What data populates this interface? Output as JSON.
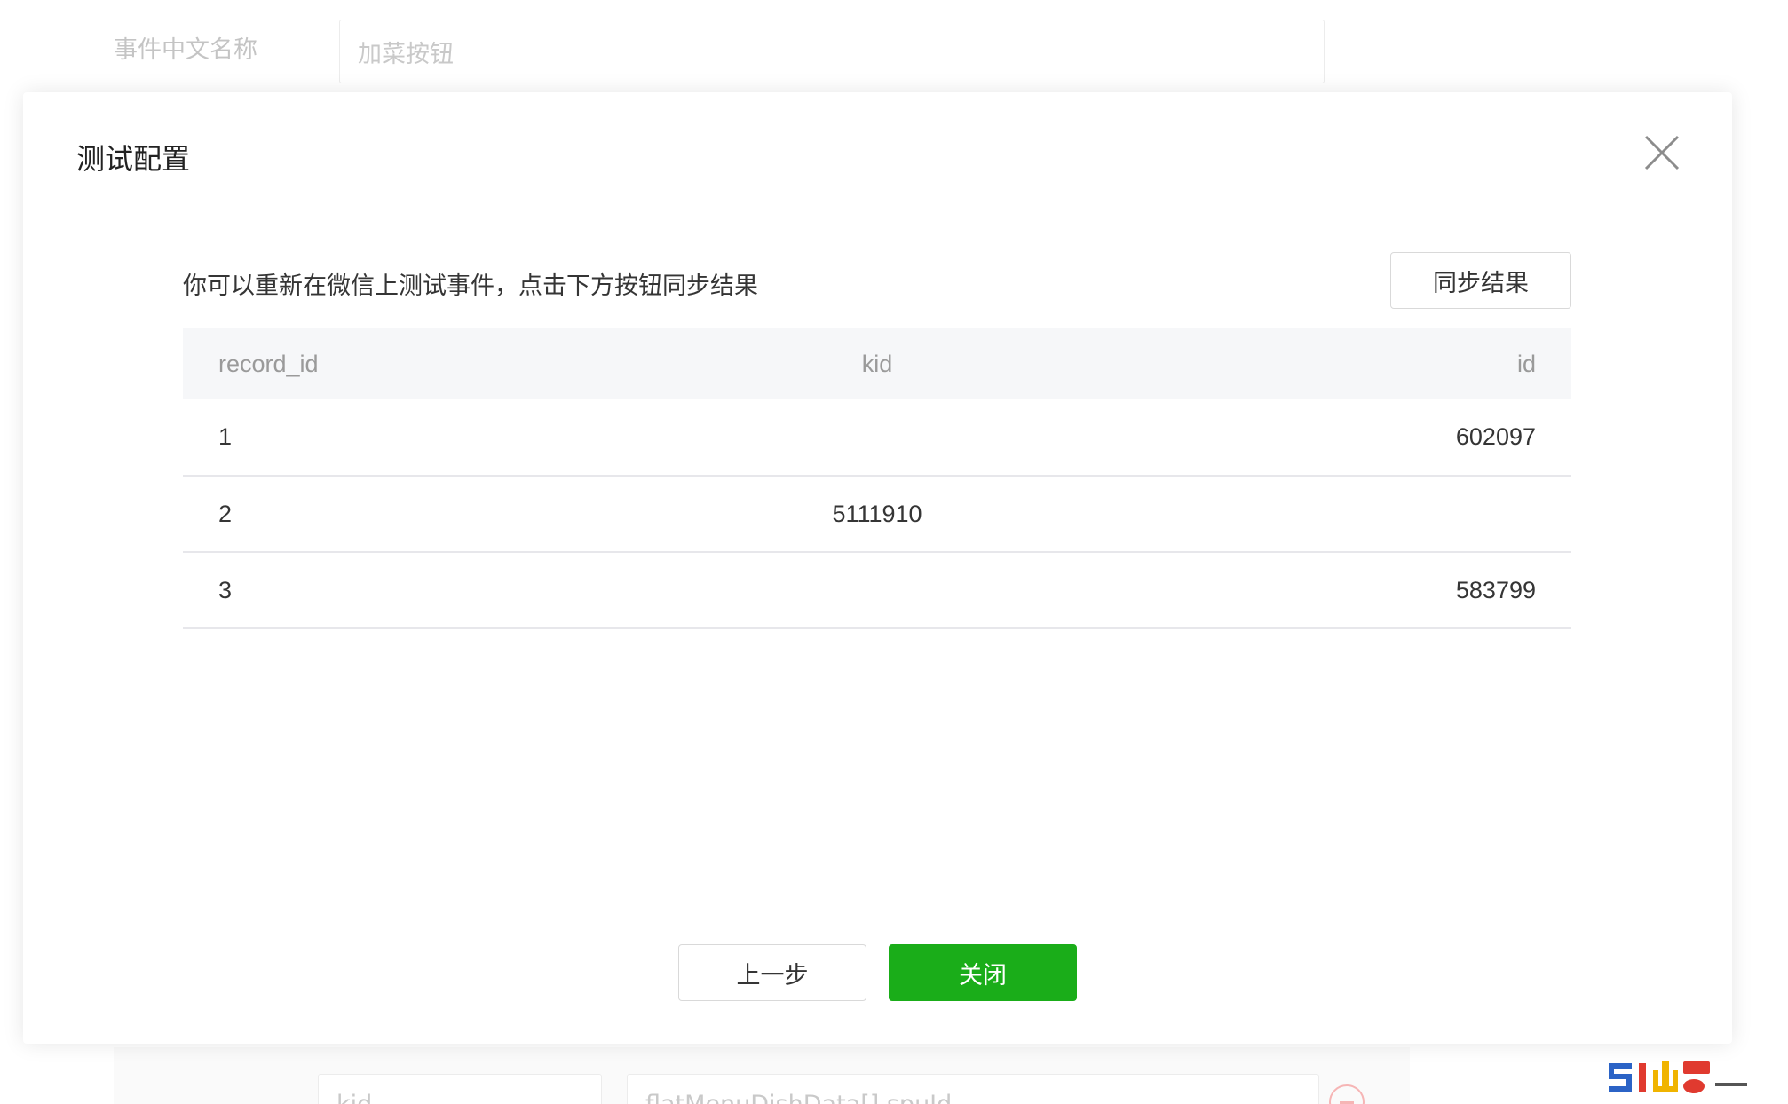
{
  "background": {
    "field_label": "事件中文名称",
    "field_value": "加菜按钮",
    "bottom_field_1": "kid",
    "bottom_field_2": "flatMenuDishData[].spuId"
  },
  "modal": {
    "title": "测试配置",
    "intro": "你可以重新在微信上测试事件，点击下方按钮同步结果",
    "sync_button": "同步结果",
    "table": {
      "headers": [
        "record_id",
        "kid",
        "id"
      ],
      "rows": [
        [
          "1",
          "",
          "602097"
        ],
        [
          "2",
          "5111910",
          ""
        ],
        [
          "3",
          "",
          "583799"
        ]
      ]
    },
    "prev_button": "上一步",
    "close_button": "关闭"
  },
  "colors": {
    "primary_green": "#1aad19",
    "header_bg": "#f6f7f9"
  }
}
